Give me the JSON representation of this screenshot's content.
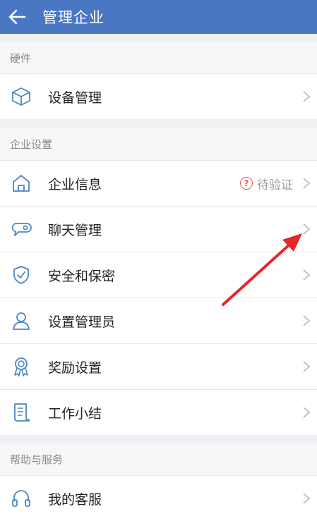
{
  "header": {
    "title": "管理企业",
    "back_icon": "arrow-left-icon"
  },
  "sections": {
    "hardware": {
      "title": "硬件"
    },
    "company_settings": {
      "title": "企业设置"
    },
    "help": {
      "title": "帮助与服务"
    }
  },
  "items": {
    "device_mgmt": {
      "label": "设备管理",
      "icon": "box-icon"
    },
    "company_info": {
      "label": "企业信息",
      "icon": "home-icon",
      "status_text": "待验证",
      "status_icon": "question-circle-icon"
    },
    "chat_mgmt": {
      "label": "聊天管理",
      "icon": "chat-bubble-icon"
    },
    "security": {
      "label": "安全和保密",
      "icon": "shield-icon"
    },
    "admin_setup": {
      "label": "设置管理员",
      "icon": "user-icon"
    },
    "rewards": {
      "label": "奖励设置",
      "icon": "medal-icon"
    },
    "work_summary": {
      "label": "工作小结",
      "icon": "document-icon"
    },
    "my_service": {
      "label": "我的客服",
      "icon": "headphones-icon"
    }
  },
  "colors": {
    "header_bg": "#4a77c3",
    "icon_blue": "#4a86c5",
    "status_red": "#e05b4b",
    "annotation_arrow": "#e8252a"
  }
}
